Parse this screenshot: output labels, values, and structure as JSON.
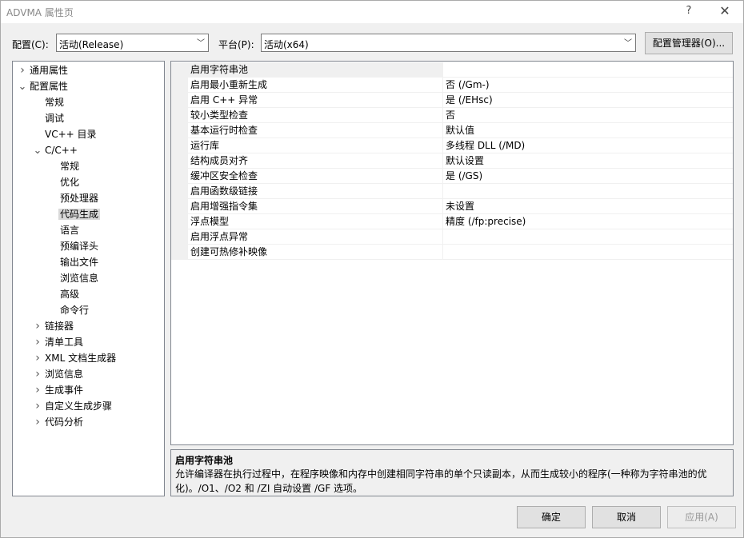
{
  "window": {
    "title": "ADVMA 属性页",
    "help_glyph": "?",
    "close_glyph": "✕"
  },
  "toolbar": {
    "config_label": "配置(C):",
    "config_value": "活动(Release)",
    "platform_label": "平台(P):",
    "platform_value": "活动(x64)",
    "config_manager_button": "配置管理器(O)..."
  },
  "tree": [
    {
      "label": "通用属性",
      "level": 0,
      "expander": "right"
    },
    {
      "label": "配置属性",
      "level": 0,
      "expander": "down"
    },
    {
      "label": "常规",
      "level": 1,
      "expander": "none"
    },
    {
      "label": "调试",
      "level": 1,
      "expander": "none"
    },
    {
      "label": "VC++ 目录",
      "level": 1,
      "expander": "none"
    },
    {
      "label": "C/C++",
      "level": 1,
      "expander": "down"
    },
    {
      "label": "常规",
      "level": 2,
      "expander": "none"
    },
    {
      "label": "优化",
      "level": 2,
      "expander": "none"
    },
    {
      "label": "预处理器",
      "level": 2,
      "expander": "none"
    },
    {
      "label": "代码生成",
      "level": 2,
      "expander": "none",
      "selected": true
    },
    {
      "label": "语言",
      "level": 2,
      "expander": "none"
    },
    {
      "label": "预编译头",
      "level": 2,
      "expander": "none"
    },
    {
      "label": "输出文件",
      "level": 2,
      "expander": "none"
    },
    {
      "label": "浏览信息",
      "level": 2,
      "expander": "none"
    },
    {
      "label": "高级",
      "level": 2,
      "expander": "none"
    },
    {
      "label": "命令行",
      "level": 2,
      "expander": "none"
    },
    {
      "label": "链接器",
      "level": 1,
      "expander": "right"
    },
    {
      "label": "清单工具",
      "level": 1,
      "expander": "right"
    },
    {
      "label": "XML 文档生成器",
      "level": 1,
      "expander": "right"
    },
    {
      "label": "浏览信息",
      "level": 1,
      "expander": "right"
    },
    {
      "label": "生成事件",
      "level": 1,
      "expander": "right"
    },
    {
      "label": "自定义生成步骤",
      "level": 1,
      "expander": "right"
    },
    {
      "label": "代码分析",
      "level": 1,
      "expander": "right"
    }
  ],
  "properties": [
    {
      "name": "启用字符串池",
      "value": "",
      "selected": true
    },
    {
      "name": "启用最小重新生成",
      "value": "否 (/Gm-)"
    },
    {
      "name": "启用 C++ 异常",
      "value": "是 (/EHsc)"
    },
    {
      "name": "较小类型检查",
      "value": "否"
    },
    {
      "name": "基本运行时检查",
      "value": "默认值"
    },
    {
      "name": "运行库",
      "value": "多线程 DLL (/MD)"
    },
    {
      "name": "结构成员对齐",
      "value": "默认设置"
    },
    {
      "name": "缓冲区安全检查",
      "value": "是 (/GS)"
    },
    {
      "name": "启用函数级链接",
      "value": ""
    },
    {
      "name": "启用增强指令集",
      "value": "未设置"
    },
    {
      "name": "浮点模型",
      "value": "精度 (/fp:precise)"
    },
    {
      "name": "启用浮点异常",
      "value": ""
    },
    {
      "name": "创建可热修补映像",
      "value": ""
    }
  ],
  "description": {
    "title": "启用字符串池",
    "text": "允许编译器在执行过程中，在程序映像和内存中创建相同字符串的单个只读副本，从而生成较小的程序(一种称为字符串池的优化)。/O1、/O2 和 /ZI 自动设置 /GF 选项。"
  },
  "buttons": {
    "ok": "确定",
    "cancel": "取消",
    "apply": "应用(A)"
  }
}
